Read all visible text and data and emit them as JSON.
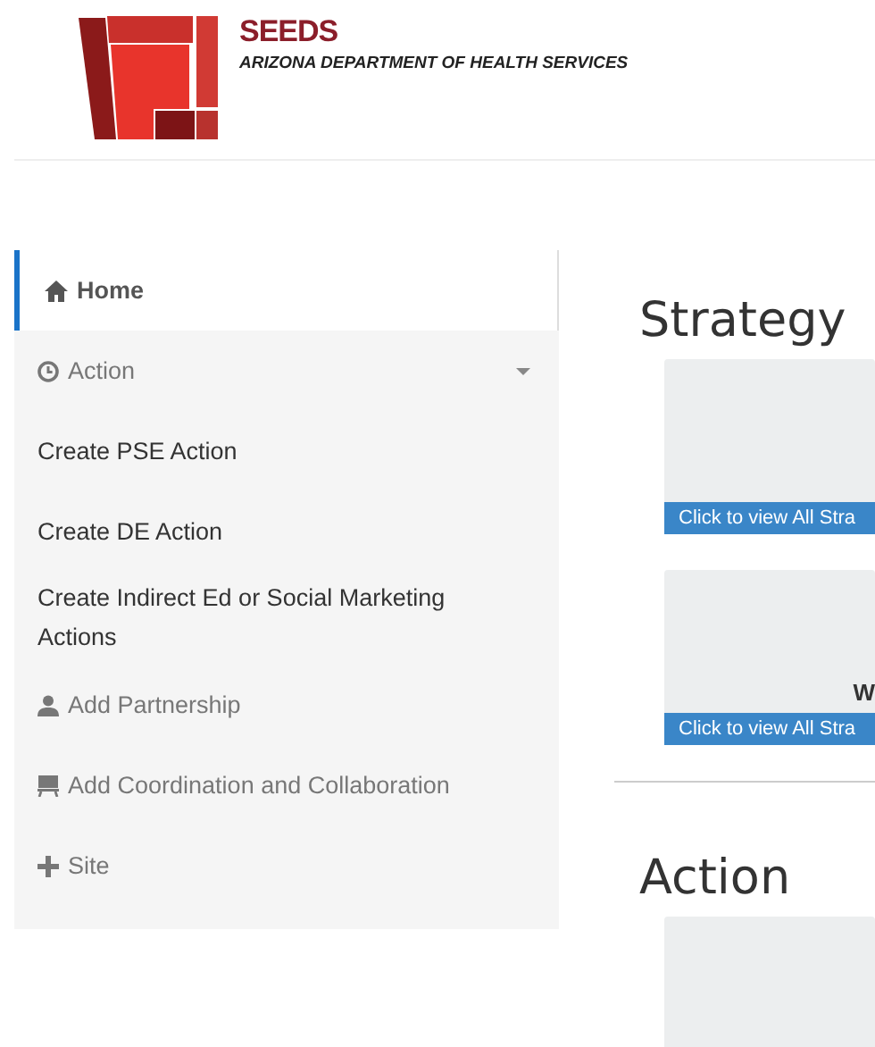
{
  "header": {
    "title": "SEEDS",
    "subtitle": "ARIZONA DEPARTMENT OF HEALTH SERVICES"
  },
  "sidebar": {
    "items": [
      {
        "kind": "link",
        "label": "Home",
        "selected": true
      },
      {
        "kind": "group",
        "label": "Action",
        "expanded": true
      },
      {
        "kind": "sub",
        "label": "Create PSE Action"
      },
      {
        "kind": "sub",
        "label": "Create DE Action"
      },
      {
        "kind": "sub",
        "label": "Create Indirect Ed or Social Marketing Actions"
      },
      {
        "kind": "link",
        "label": "Add Partnership",
        "selected": false
      },
      {
        "kind": "link",
        "label": "Add Coordination and Collaboration",
        "selected": false
      },
      {
        "kind": "link",
        "label": "Site",
        "selected": false
      }
    ]
  },
  "sections": [
    {
      "title": "Strategy",
      "cards": [
        {
          "kind": "summary",
          "link": "Click to view All Stra"
        },
        {
          "kind": "summary",
          "text": "W",
          "link": "Click to view All Stra"
        }
      ]
    },
    {
      "title": "Action",
      "cards": [
        {
          "kind": "blank"
        }
      ]
    }
  ]
}
